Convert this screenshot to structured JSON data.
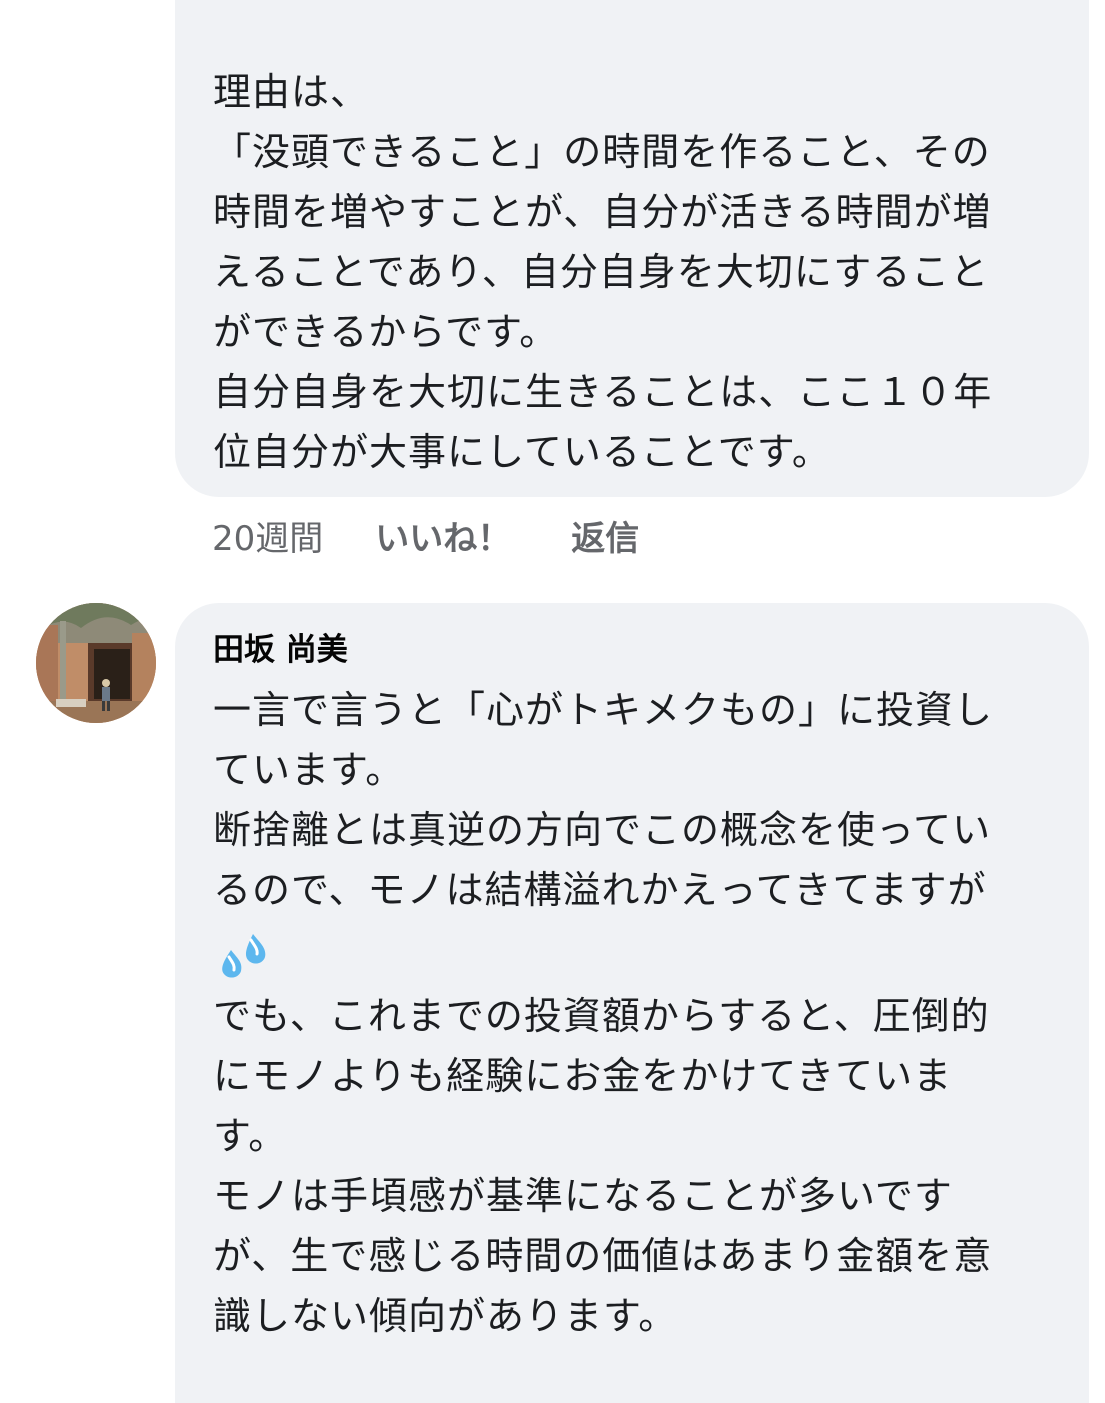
{
  "comments": [
    {
      "lines": [
        "理由は、",
        "「没頭できること」の時間を作ること、その",
        "時間を増やすことが、自分が活きる時間が増",
        "えることであり、自分自身を大切にすること",
        "ができるからです。",
        "自分自身を大切に生きることは、ここ１０年",
        "位自分が大事にしていることです。"
      ],
      "time": "20週間",
      "like_label": "いいね！",
      "reply_label": "返信"
    },
    {
      "author": "田坂 尚美",
      "avatar_icon": "profile-photo",
      "lines_before_emoji": [
        "一言で言うと「心がトキメクもの」に投資し",
        "ています。",
        "断捨離とは真逆の方向でこの概念を使ってい",
        "るので、モノは結構溢れかえってきてますが"
      ],
      "emoji_icon": "sweat-droplets-icon",
      "lines_after_emoji": [
        "でも、これまでの投資額からすると、圧倒的",
        "にモノよりも経験にお金をかけてきていま",
        "す。",
        "モノは手頃感が基準になることが多いです",
        "が、生で感じる時間の価値はあまり金額を意",
        "識しない傾向があります。"
      ]
    }
  ],
  "colors": {
    "bubble_bg": "#f0f2f5",
    "text": "#1c1e21",
    "meta": "#65676b",
    "emoji": "#5db7ee"
  }
}
